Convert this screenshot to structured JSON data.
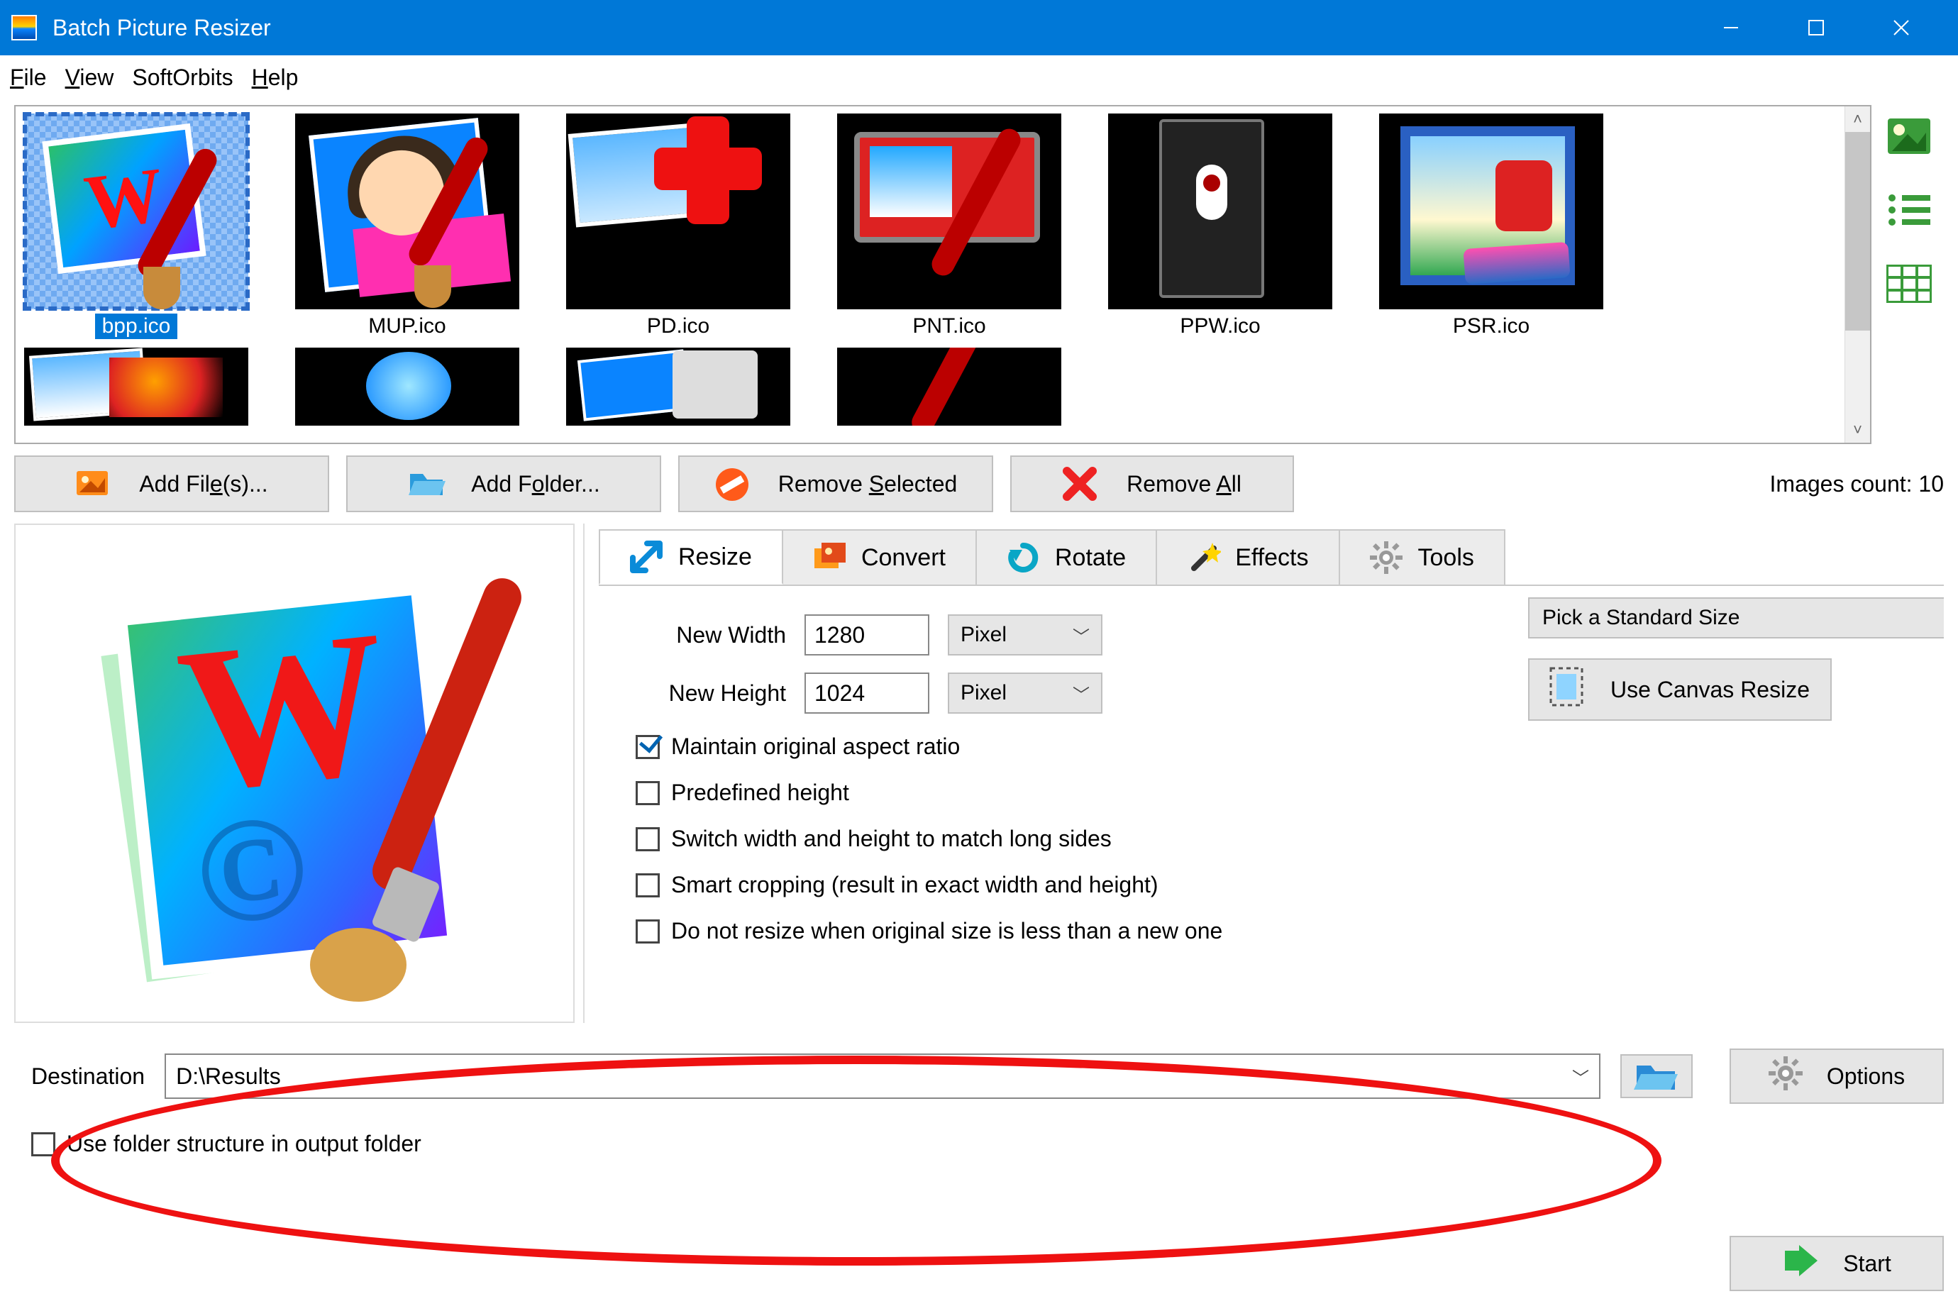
{
  "window": {
    "title": "Batch Picture Resizer"
  },
  "menu": {
    "file": "File",
    "view": "View",
    "softorbits": "SoftOrbits",
    "help": "Help"
  },
  "gallery": {
    "items": [
      {
        "label": "bpp.ico"
      },
      {
        "label": "MUP.ico"
      },
      {
        "label": "PD.ico"
      },
      {
        "label": "PNT.ico"
      },
      {
        "label": "PPW.ico"
      },
      {
        "label": "PSR.ico"
      }
    ]
  },
  "actions": {
    "add_files": "Add File(s)...",
    "add_folder": "Add Folder...",
    "remove_selected": "Remove Selected",
    "remove_all": "Remove All",
    "images_count_label": "Images count: 10"
  },
  "tabs": {
    "resize": "Resize",
    "convert": "Convert",
    "rotate": "Rotate",
    "effects": "Effects",
    "tools": "Tools"
  },
  "resize": {
    "new_width_label": "New Width",
    "new_width_value": "1280",
    "new_height_label": "New Height",
    "new_height_value": "1024",
    "unit": "Pixel",
    "standard_size": "Pick a Standard Size",
    "canvas_resize": "Use Canvas Resize",
    "chk_aspect": "Maintain original aspect ratio",
    "chk_predef_height": "Predefined height",
    "chk_switch": "Switch width and height to match long sides",
    "chk_smart": "Smart cropping (result in exact width and height)",
    "chk_no_resize": "Do not resize when original size is less than a new one"
  },
  "destination": {
    "label": "Destination",
    "path": "D:\\Results",
    "use_folder_struct": "Use folder structure in output folder"
  },
  "side": {
    "options": "Options",
    "start": "Start"
  }
}
